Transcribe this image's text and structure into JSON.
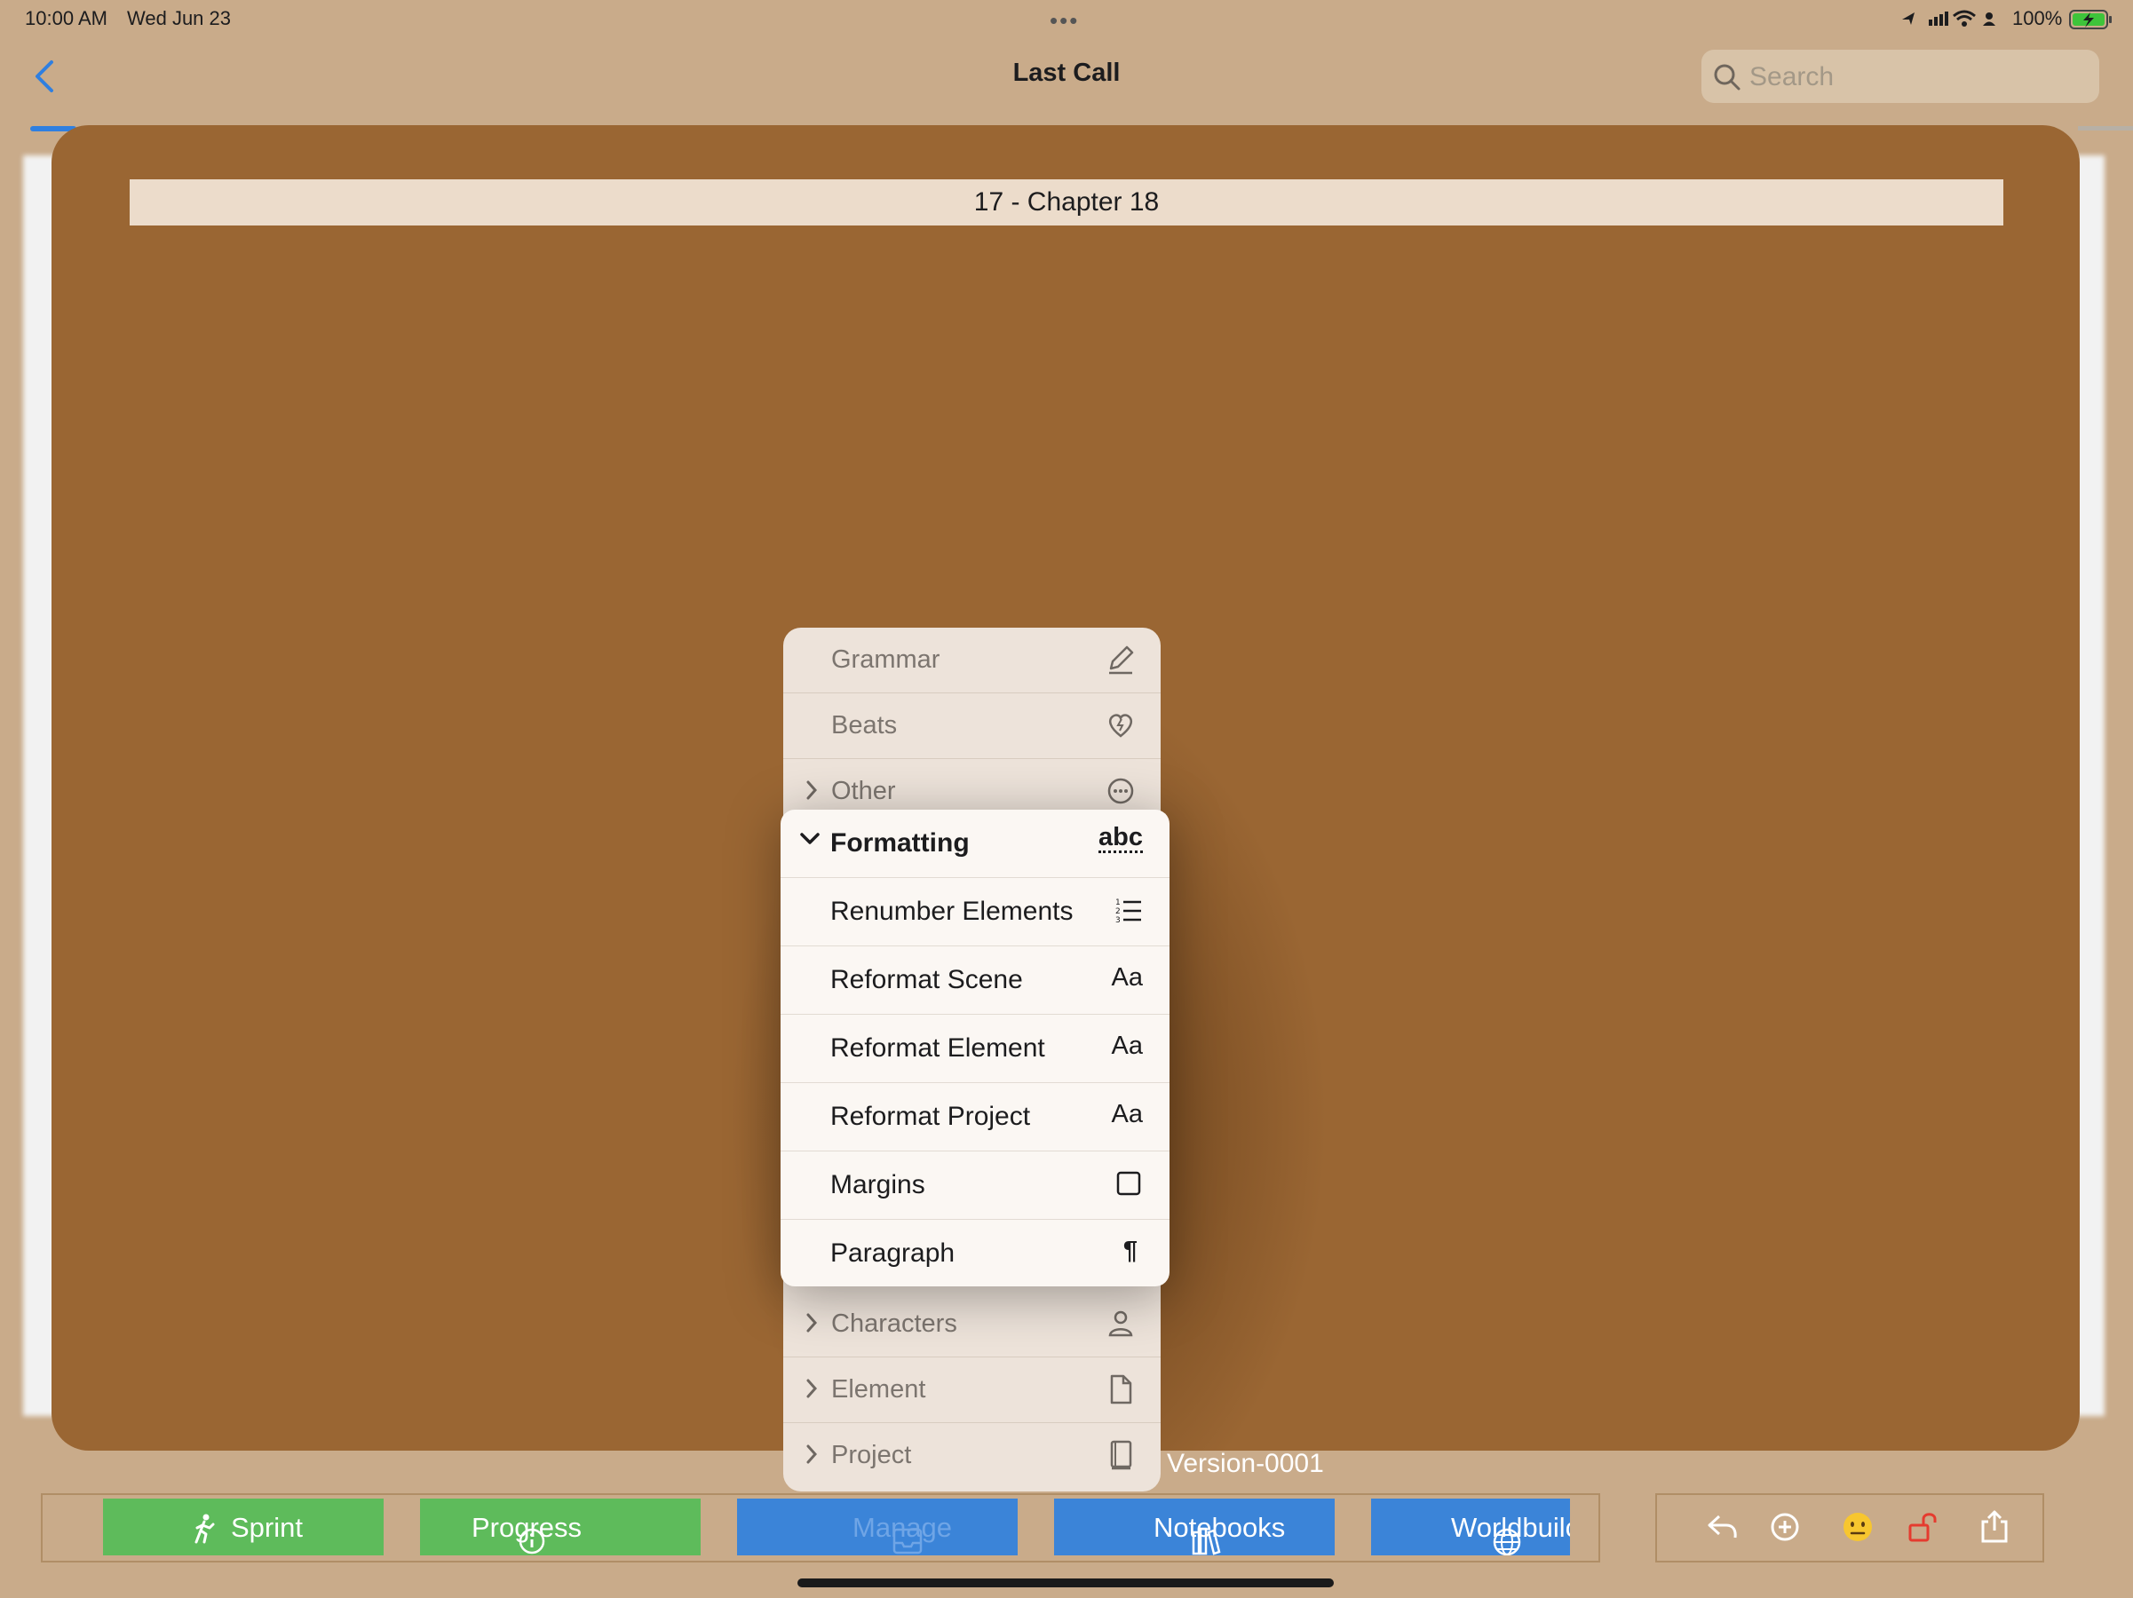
{
  "status_bar": {
    "time": "10:00 AM",
    "date": "Wed Jun 23",
    "battery": "100%"
  },
  "nav": {
    "title": "Last Call",
    "search_placeholder": "Search"
  },
  "document": {
    "chapter_title": "17 - Chapter 18",
    "version": "Version-0001"
  },
  "menu": {
    "top_items": [
      {
        "label": "Grammar",
        "icon": "pencil-icon"
      },
      {
        "label": "Beats",
        "icon": "heart-bolt-icon"
      },
      {
        "label": "Other",
        "icon": "ellipsis-circle-icon"
      }
    ],
    "submenu": {
      "header": {
        "label": "Formatting",
        "icon_text": "abc"
      },
      "items": [
        {
          "label": "Renumber Elements",
          "icon": "numbered-list-icon"
        },
        {
          "label": "Reformat Scene",
          "icon_text": "Aa"
        },
        {
          "label": "Reformat Element",
          "icon_text": "Aa"
        },
        {
          "label": "Reformat Project",
          "icon_text": "Aa"
        },
        {
          "label": "Margins",
          "icon": "square-icon"
        },
        {
          "label": "Paragraph",
          "icon_text": "¶"
        }
      ]
    },
    "bottom_items": [
      {
        "label": "Characters",
        "icon": "person-icon"
      },
      {
        "label": "Element",
        "icon": "document-icon"
      },
      {
        "label": "Project",
        "icon": "book-icon"
      }
    ]
  },
  "toolbar": {
    "sprint": "Sprint",
    "progress": "Progress",
    "manage": "Manage",
    "notebooks": "Notebooks",
    "worldbuilding": "Worldbuilc"
  },
  "colors": {
    "accent_blue": "#3b84d8",
    "accent_green": "#5ebb5b",
    "board_brown": "#9a6633"
  }
}
